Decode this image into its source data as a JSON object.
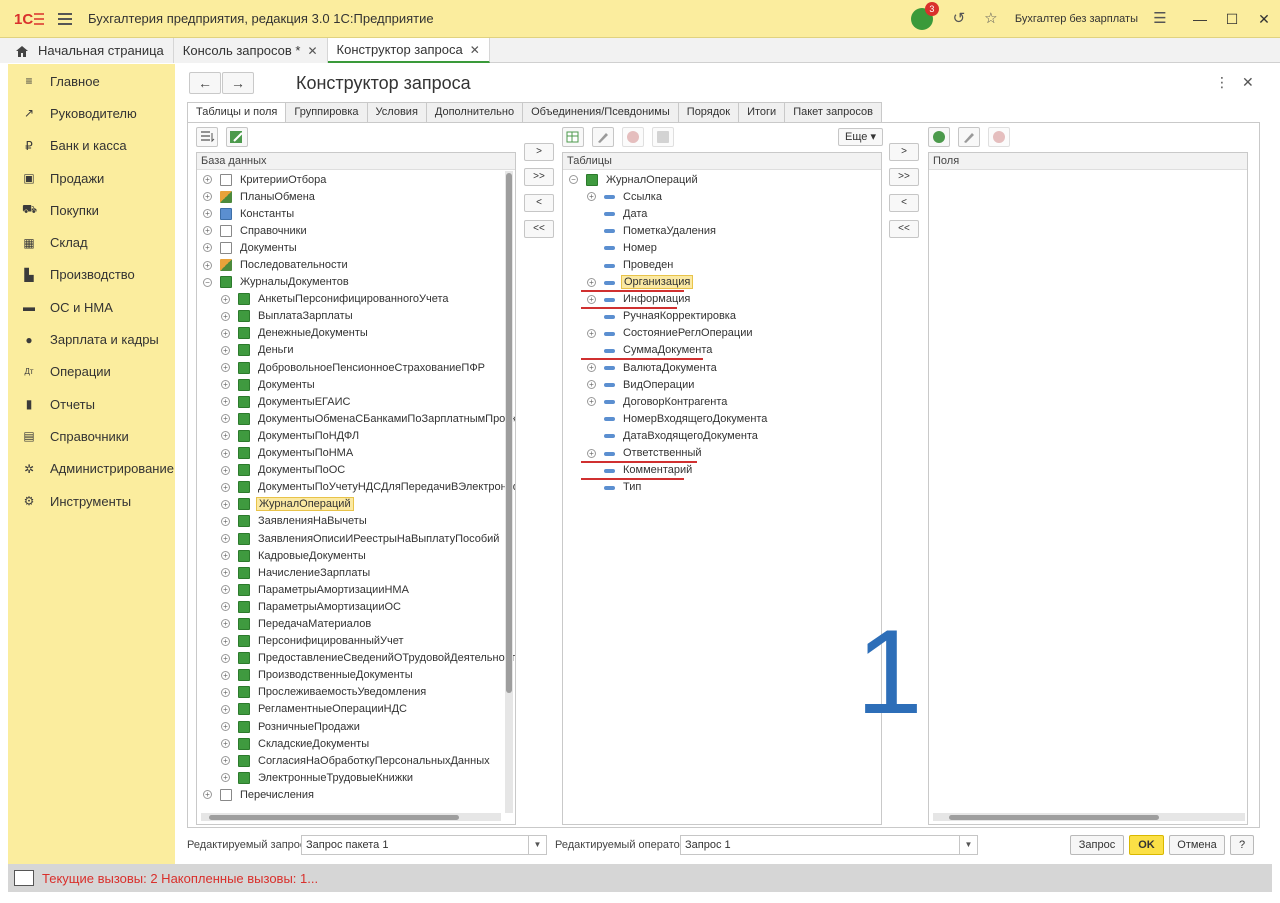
{
  "app": {
    "title": "Бухгалтерия предприятия, редакция 3.0 1С:Предприятие",
    "notifications_count": "3",
    "user": "Бухгалтер без зарплаты"
  },
  "tabs": [
    {
      "label": "Начальная страница"
    },
    {
      "label": "Консоль запросов *"
    },
    {
      "label": "Конструктор запроса"
    }
  ],
  "sidebar": [
    {
      "label": "Главное",
      "icon": "≡"
    },
    {
      "label": "Руководителю",
      "icon": "↗"
    },
    {
      "label": "Банк и касса",
      "icon": "₽"
    },
    {
      "label": "Продажи",
      "icon": "▣"
    },
    {
      "label": "Покупки",
      "icon": "⛟"
    },
    {
      "label": "Склад",
      "icon": "▦"
    },
    {
      "label": "Производство",
      "icon": "▙"
    },
    {
      "label": "ОС и НМА",
      "icon": "▬"
    },
    {
      "label": "Зарплата и кадры",
      "icon": "●"
    },
    {
      "label": "Операции",
      "icon": "Дт"
    },
    {
      "label": "Отчеты",
      "icon": "▮"
    },
    {
      "label": "Справочники",
      "icon": "▤"
    },
    {
      "label": "Администрирование",
      "icon": "✲"
    },
    {
      "label": "Инструменты",
      "icon": "⚙"
    }
  ],
  "form": {
    "title": "Конструктор запроса",
    "tabs": [
      "Таблицы и поля",
      "Группировка",
      "Условия",
      "Дополнительно",
      "Объединения/Псевдонимы",
      "Порядок",
      "Итоги",
      "Пакет запросов"
    ],
    "db_header": "База данных",
    "tables_header": "Таблицы",
    "fields_header": "Поля",
    "more_button": "Еще",
    "move_buttons": [
      ">",
      ">>",
      "<",
      "<<"
    ],
    "db_tree": [
      {
        "label": "КритерииОтбора",
        "level": 0,
        "exp": "+",
        "icon": "gray"
      },
      {
        "label": "ПланыОбмена",
        "level": 0,
        "exp": "+",
        "icon": "multi"
      },
      {
        "label": "Константы",
        "level": 0,
        "exp": "+",
        "icon": "blue"
      },
      {
        "label": "Справочники",
        "level": 0,
        "exp": "+",
        "icon": "gray"
      },
      {
        "label": "Документы",
        "level": 0,
        "exp": "+",
        "icon": "gray"
      },
      {
        "label": "Последовательности",
        "level": 0,
        "exp": "+",
        "icon": "multi"
      },
      {
        "label": "ЖурналыДокументов",
        "level": 0,
        "exp": "−",
        "icon": "green"
      },
      {
        "label": "АнкетыПерсонифицированногоУчета",
        "level": 1,
        "exp": "+",
        "icon": "green"
      },
      {
        "label": "ВыплатаЗарплаты",
        "level": 1,
        "exp": "+",
        "icon": "green"
      },
      {
        "label": "ДенежныеДокументы",
        "level": 1,
        "exp": "+",
        "icon": "green"
      },
      {
        "label": "Деньги",
        "level": 1,
        "exp": "+",
        "icon": "green"
      },
      {
        "label": "ДобровольноеПенсионноеСтрахованиеПФР",
        "level": 1,
        "exp": "+",
        "icon": "green"
      },
      {
        "label": "Документы",
        "level": 1,
        "exp": "+",
        "icon": "green"
      },
      {
        "label": "ДокументыЕГАИС",
        "level": 1,
        "exp": "+",
        "icon": "green"
      },
      {
        "label": "ДокументыОбменаСБанкамиПоЗарплатнымПроекта",
        "level": 1,
        "exp": "+",
        "icon": "green"
      },
      {
        "label": "ДокументыПоНДФЛ",
        "level": 1,
        "exp": "+",
        "icon": "green"
      },
      {
        "label": "ДокументыПоНМА",
        "level": 1,
        "exp": "+",
        "icon": "green"
      },
      {
        "label": "ДокументыПоОС",
        "level": 1,
        "exp": "+",
        "icon": "green"
      },
      {
        "label": "ДокументыПоУчетуНДСДляПередачиВЭлектронном",
        "level": 1,
        "exp": "+",
        "icon": "green"
      },
      {
        "label": "ЖурналОпераций",
        "level": 1,
        "exp": "+",
        "icon": "green",
        "highlight": true
      },
      {
        "label": "ЗаявленияНаВычеты",
        "level": 1,
        "exp": "+",
        "icon": "green"
      },
      {
        "label": "ЗаявленияОписиИРеестрыНаВыплатуПособий",
        "level": 1,
        "exp": "+",
        "icon": "green"
      },
      {
        "label": "КадровыеДокументы",
        "level": 1,
        "exp": "+",
        "icon": "green"
      },
      {
        "label": "НачислениеЗарплаты",
        "level": 1,
        "exp": "+",
        "icon": "green"
      },
      {
        "label": "ПараметрыАмортизацииНМА",
        "level": 1,
        "exp": "+",
        "icon": "green"
      },
      {
        "label": "ПараметрыАмортизацииОС",
        "level": 1,
        "exp": "+",
        "icon": "green"
      },
      {
        "label": "ПередачаМатериалов",
        "level": 1,
        "exp": "+",
        "icon": "green"
      },
      {
        "label": "ПерсонифицированныйУчет",
        "level": 1,
        "exp": "+",
        "icon": "green"
      },
      {
        "label": "ПредоставлениеСведенийОТрудовойДеятельности",
        "level": 1,
        "exp": "+",
        "icon": "green"
      },
      {
        "label": "ПроизводственныеДокументы",
        "level": 1,
        "exp": "+",
        "icon": "green"
      },
      {
        "label": "ПрослеживаемостьУведомления",
        "level": 1,
        "exp": "+",
        "icon": "green"
      },
      {
        "label": "РегламентныеОперацииНДС",
        "level": 1,
        "exp": "+",
        "icon": "green"
      },
      {
        "label": "РозничныеПродажи",
        "level": 1,
        "exp": "+",
        "icon": "green"
      },
      {
        "label": "СкладскиеДокументы",
        "level": 1,
        "exp": "+",
        "icon": "green"
      },
      {
        "label": "СогласияНаОбработкуПерсональныхДанных",
        "level": 1,
        "exp": "+",
        "icon": "green"
      },
      {
        "label": "ЭлектронныеТрудовыеКнижки",
        "level": 1,
        "exp": "+",
        "icon": "green"
      },
      {
        "label": "Перечисления",
        "level": 0,
        "exp": "+",
        "icon": "gray"
      }
    ],
    "tables_tree": [
      {
        "label": "ЖурналОпераций",
        "level": 0,
        "exp": "−",
        "icon": "green"
      },
      {
        "label": "Ссылка",
        "level": 1,
        "exp": "+",
        "icon": "field"
      },
      {
        "label": "Дата",
        "level": 1,
        "exp": "",
        "icon": "field"
      },
      {
        "label": "ПометкаУдаления",
        "level": 1,
        "exp": "",
        "icon": "field"
      },
      {
        "label": "Номер",
        "level": 1,
        "exp": "",
        "icon": "field"
      },
      {
        "label": "Проведен",
        "level": 1,
        "exp": "",
        "icon": "field"
      },
      {
        "label": "Организация",
        "level": 1,
        "exp": "+",
        "icon": "field",
        "highlight": true,
        "underline": true
      },
      {
        "label": "Информация",
        "level": 1,
        "exp": "+",
        "icon": "field",
        "underline": true
      },
      {
        "label": "РучнаяКорректировка",
        "level": 1,
        "exp": "",
        "icon": "field"
      },
      {
        "label": "СостояниеРеглОперации",
        "level": 1,
        "exp": "+",
        "icon": "field"
      },
      {
        "label": "СуммаДокумента",
        "level": 1,
        "exp": "",
        "icon": "field",
        "underline": true
      },
      {
        "label": "ВалютаДокумента",
        "level": 1,
        "exp": "+",
        "icon": "field"
      },
      {
        "label": "ВидОперации",
        "level": 1,
        "exp": "+",
        "icon": "field"
      },
      {
        "label": "ДоговорКонтрагента",
        "level": 1,
        "exp": "+",
        "icon": "field"
      },
      {
        "label": "НомерВходящегоДокумента",
        "level": 1,
        "exp": "",
        "icon": "field"
      },
      {
        "label": "ДатаВходящегоДокумента",
        "level": 1,
        "exp": "",
        "icon": "field"
      },
      {
        "label": "Ответственный",
        "level": 1,
        "exp": "+",
        "icon": "field",
        "underline": true
      },
      {
        "label": "Комментарий",
        "level": 1,
        "exp": "",
        "icon": "field",
        "underline": true
      },
      {
        "label": "Тип",
        "level": 1,
        "exp": "",
        "icon": "field"
      }
    ],
    "annotation_number": "1",
    "edited_query_label": "Редактируемый запрос:",
    "edited_query_value": "Запрос пакета 1",
    "edited_operator_label": "Редактируемый оператор:",
    "edited_operator_value": "Запрос 1",
    "btn_query": "Запрос",
    "btn_ok": "OK",
    "btn_cancel": "Отмена",
    "btn_help": "?"
  },
  "status": {
    "text": "Текущие вызовы: 2   Накопленные вызовы: 1..."
  },
  "colors": {
    "accent_yellow": "#fbed9e",
    "active_green": "#3a9a3a",
    "annotation_blue": "#2d6eb8",
    "underline_red": "#d03030"
  }
}
